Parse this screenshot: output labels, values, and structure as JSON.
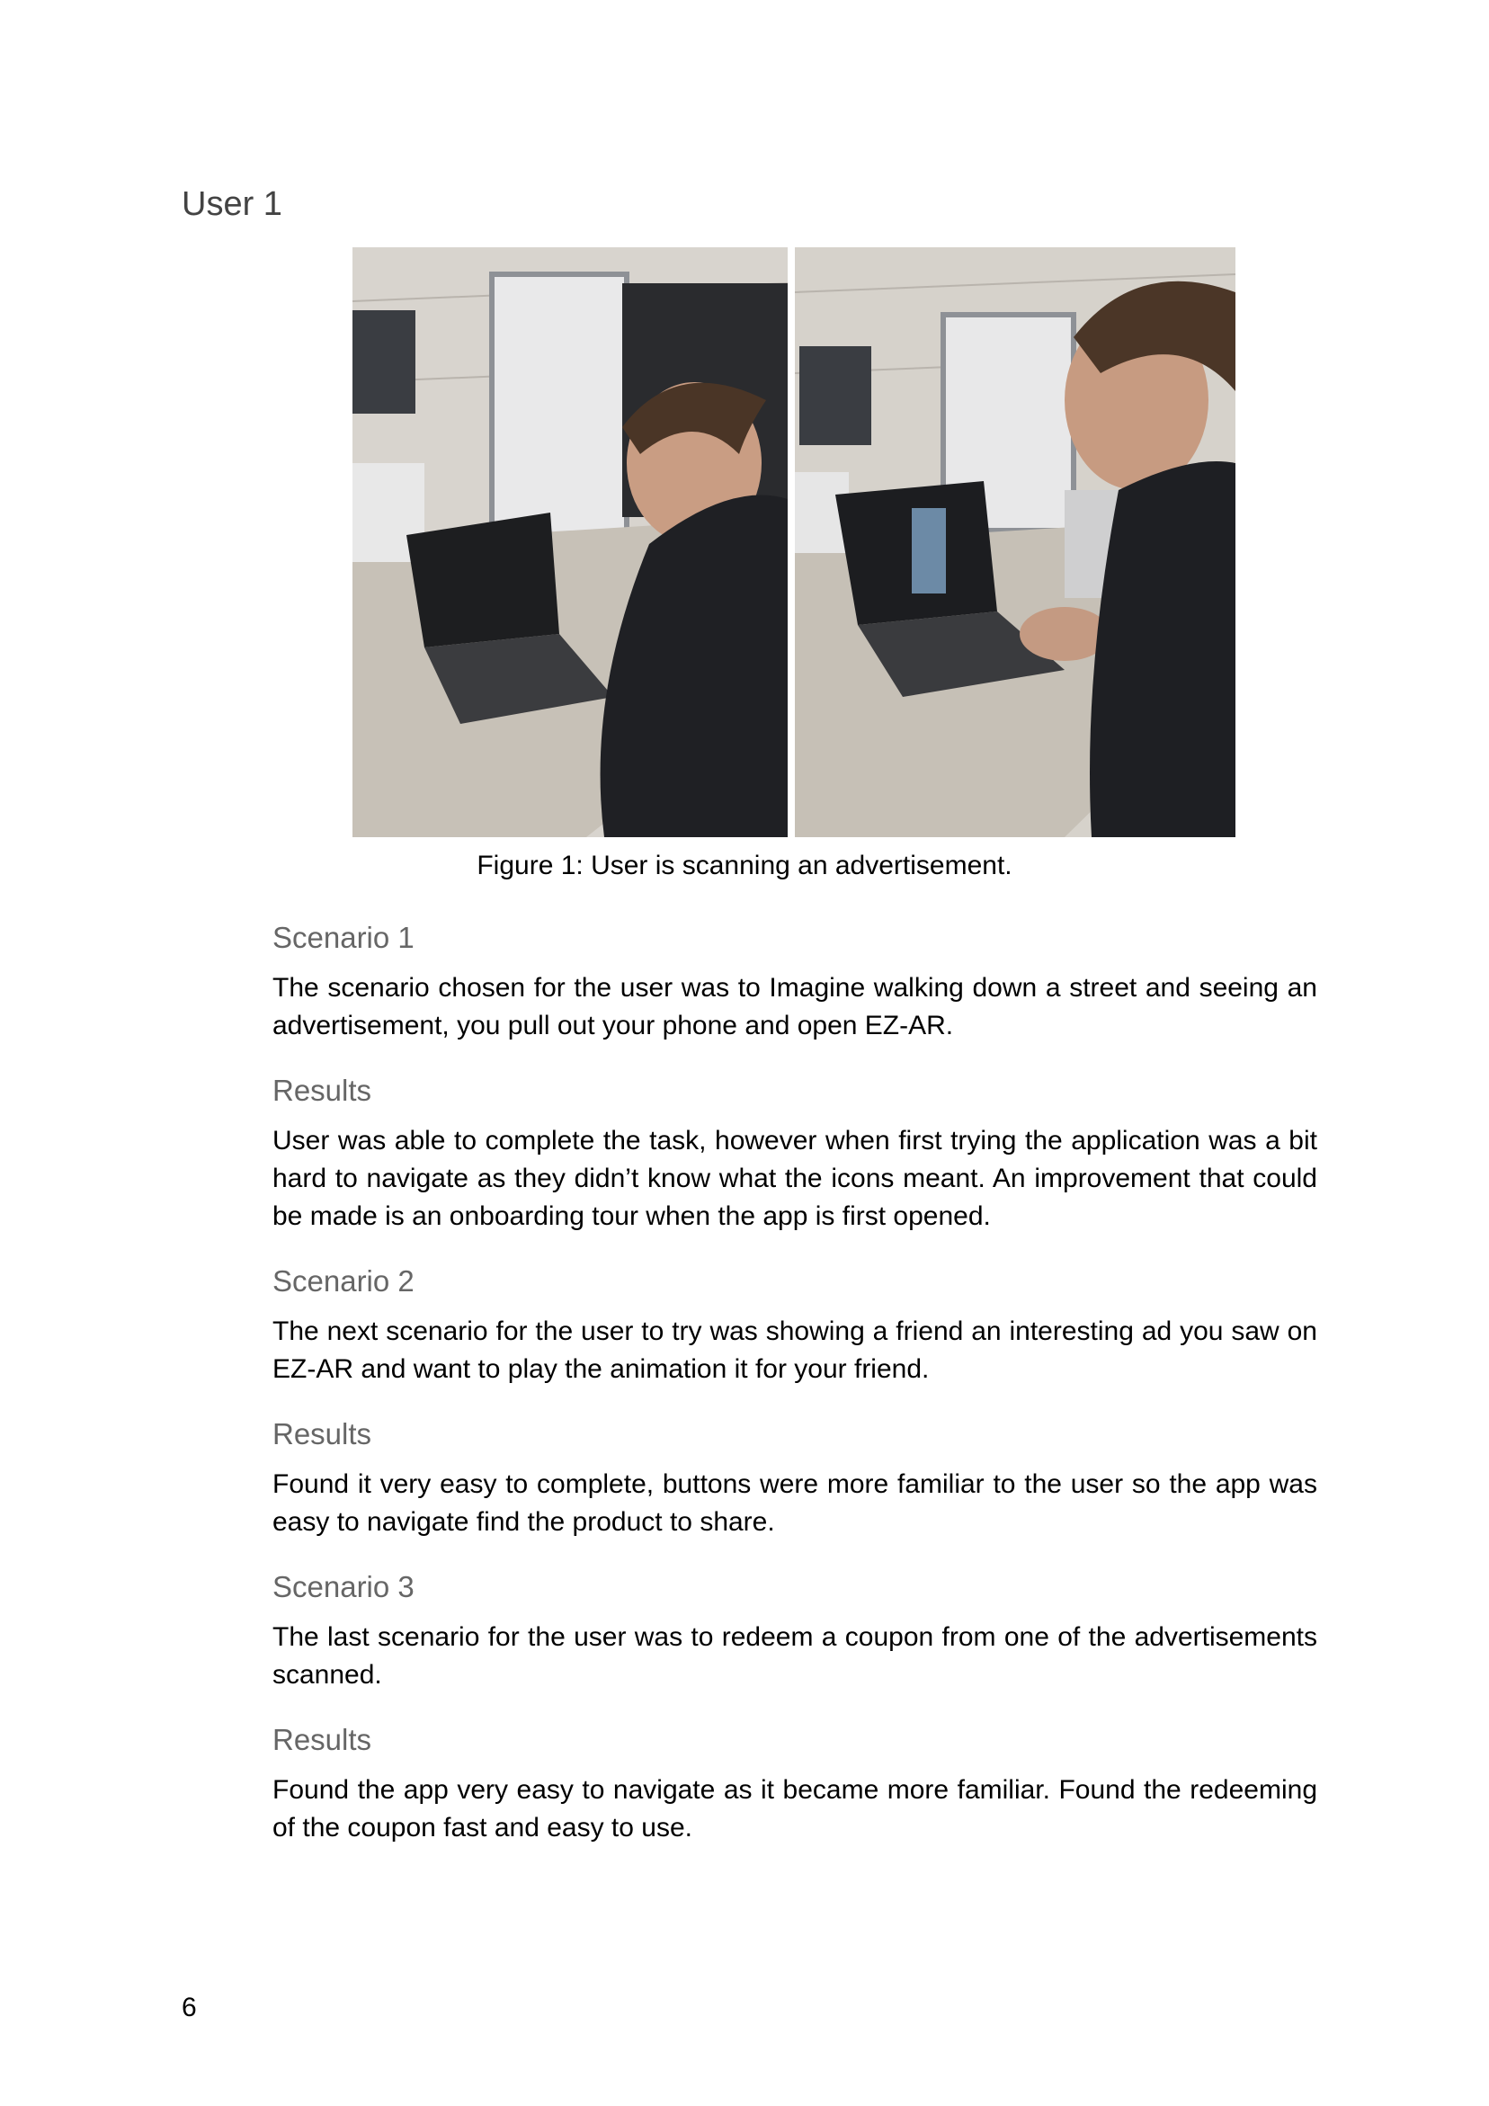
{
  "heading": "User 1",
  "figure": {
    "caption": "Figure 1: User is scanning an advertisement.",
    "photos": [
      {
        "description_icon": "photo-user-laptop-left"
      },
      {
        "description_icon": "photo-user-laptop-right"
      }
    ]
  },
  "sections": [
    {
      "heading": "Scenario 1",
      "text": "The scenario chosen for the user was to Imagine walking down a street and seeing an advertisement, you pull out your phone and open EZ-AR."
    },
    {
      "heading": "Results",
      "text": "User was able to complete the task, however when first trying the application was a bit hard to navigate as they didn’t know what the icons meant. An improvement that could be made is an onboarding tour when the app is first opened."
    },
    {
      "heading": "Scenario 2",
      "text": "The next scenario for the user to try was showing a friend an interesting ad you saw on EZ-AR and want to play the animation it for your friend."
    },
    {
      "heading": "Results",
      "text": "Found it very easy to complete, buttons were more familiar to the user so the app was easy to navigate find the product to share."
    },
    {
      "heading": "Scenario 3",
      "text": "The last scenario for the user was to redeem a coupon from one of the advertisements scanned."
    },
    {
      "heading": "Results",
      "text": "Found the app very easy to navigate as it became more familiar. Found the redeeming of the coupon fast and easy to use."
    }
  ],
  "page_number": "6"
}
